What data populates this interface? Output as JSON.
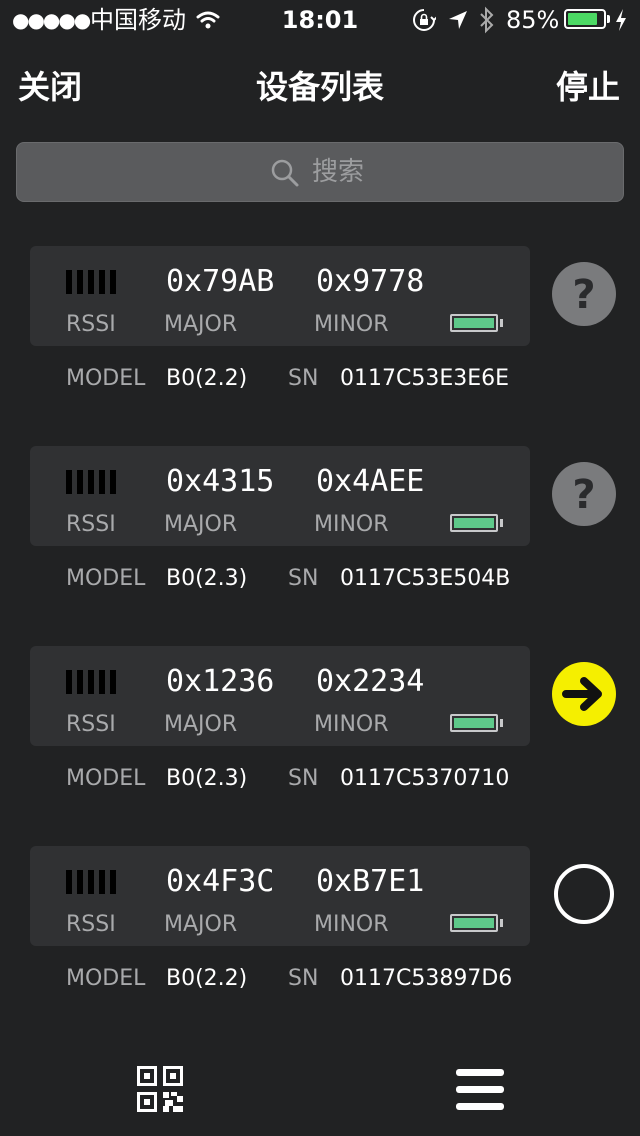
{
  "status_bar": {
    "signal": "●●●●●",
    "carrier": "中国移动",
    "time": "18:01",
    "battery_percent": "85%",
    "battery_level": 0.85,
    "battery_color": "#4cd964"
  },
  "nav": {
    "left_button": "关闭",
    "title": "设备列表",
    "right_button": "停止"
  },
  "search": {
    "placeholder": "搜索",
    "value": ""
  },
  "labels": {
    "rssi": "RSSI",
    "major": "MAJOR",
    "minor": "MINOR",
    "model": "MODEL",
    "sn": "SN"
  },
  "devices": [
    {
      "major": "0x79AB",
      "minor": "0x9778",
      "model": "B0(2.2)",
      "sn": "0117C53E3E6E",
      "status_icon": "question-icon",
      "status_color": "#7a7b7d"
    },
    {
      "major": "0x4315",
      "minor": "0x4AEE",
      "model": "B0(2.3)",
      "sn": "0117C53E504B",
      "status_icon": "question-icon",
      "status_color": "#7a7b7d"
    },
    {
      "major": "0x1236",
      "minor": "0x2234",
      "model": "B0(2.3)",
      "sn": "0117C5370710",
      "status_icon": "arrow-right-icon",
      "status_color": "#f5ef00"
    },
    {
      "major": "0x4F3C",
      "minor": "0xB7E1",
      "model": "B0(2.2)",
      "sn": "0117C53897D6",
      "status_icon": "empty-circle-icon",
      "status_color": "#ffffff"
    }
  ],
  "toolbar": {
    "left_icon": "qr-code-icon",
    "right_icon": "menu-icon"
  }
}
